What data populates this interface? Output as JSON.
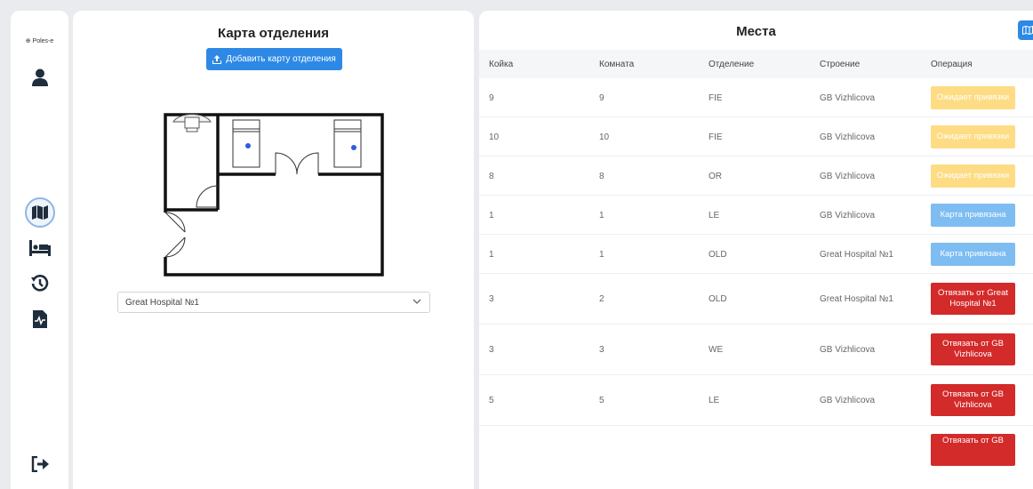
{
  "sidebar": {
    "logo_text": "Poles-e",
    "icons": [
      "user-icon",
      "map-icon",
      "bed-icon",
      "history-icon",
      "medical-file-icon",
      "logout-icon"
    ],
    "accent": "#1f2d3d"
  },
  "map_panel": {
    "title": "Карта отделения",
    "add_button_label": "Добавить карту отделения",
    "select_value": "Great Hospital №1"
  },
  "places_panel": {
    "title": "Места",
    "columns": [
      "Койка",
      "Комната",
      "Отделение",
      "Строение",
      "Операция"
    ],
    "rows": [
      {
        "bed": "9",
        "room": "9",
        "department": "FIE",
        "building": "GB Vizhlicova",
        "operation": "Ожидает привязки",
        "status": "waiting"
      },
      {
        "bed": "10",
        "room": "10",
        "department": "FIE",
        "building": "GB Vizhlicova",
        "operation": "Ожидает привязки",
        "status": "waiting"
      },
      {
        "bed": "8",
        "room": "8",
        "department": "OR",
        "building": "GB Vizhlicova",
        "operation": "Ожидает привязки",
        "status": "waiting"
      },
      {
        "bed": "1",
        "room": "1",
        "department": "LE",
        "building": "GB Vizhlicova",
        "operation": "Карта привязана",
        "status": "bound"
      },
      {
        "bed": "1",
        "room": "1",
        "department": "OLD",
        "building": "Great Hospital №1",
        "operation": "Карта привязана",
        "status": "bound"
      },
      {
        "bed": "3",
        "room": "2",
        "department": "OLD",
        "building": "Great Hospital №1",
        "operation": "Отвязать от Great Hospital №1",
        "status": "unbind"
      },
      {
        "bed": "3",
        "room": "3",
        "department": "WE",
        "building": "GB Vizhlicova",
        "operation": "Отвязать от GB Vizhlicova",
        "status": "unbind"
      },
      {
        "bed": "5",
        "room": "5",
        "department": "LE",
        "building": "GB Vizhlicova",
        "operation": "Отвязать от GB Vizhlicova",
        "status": "unbind"
      },
      {
        "bed": "",
        "room": "",
        "department": "",
        "building": "",
        "operation": "Отвязать от GB",
        "status": "unbind"
      }
    ],
    "colors": {
      "waiting": "#fddc84",
      "bound": "#7dbdf2",
      "unbind": "#d32a2a",
      "primary": "#2d89e5"
    }
  }
}
